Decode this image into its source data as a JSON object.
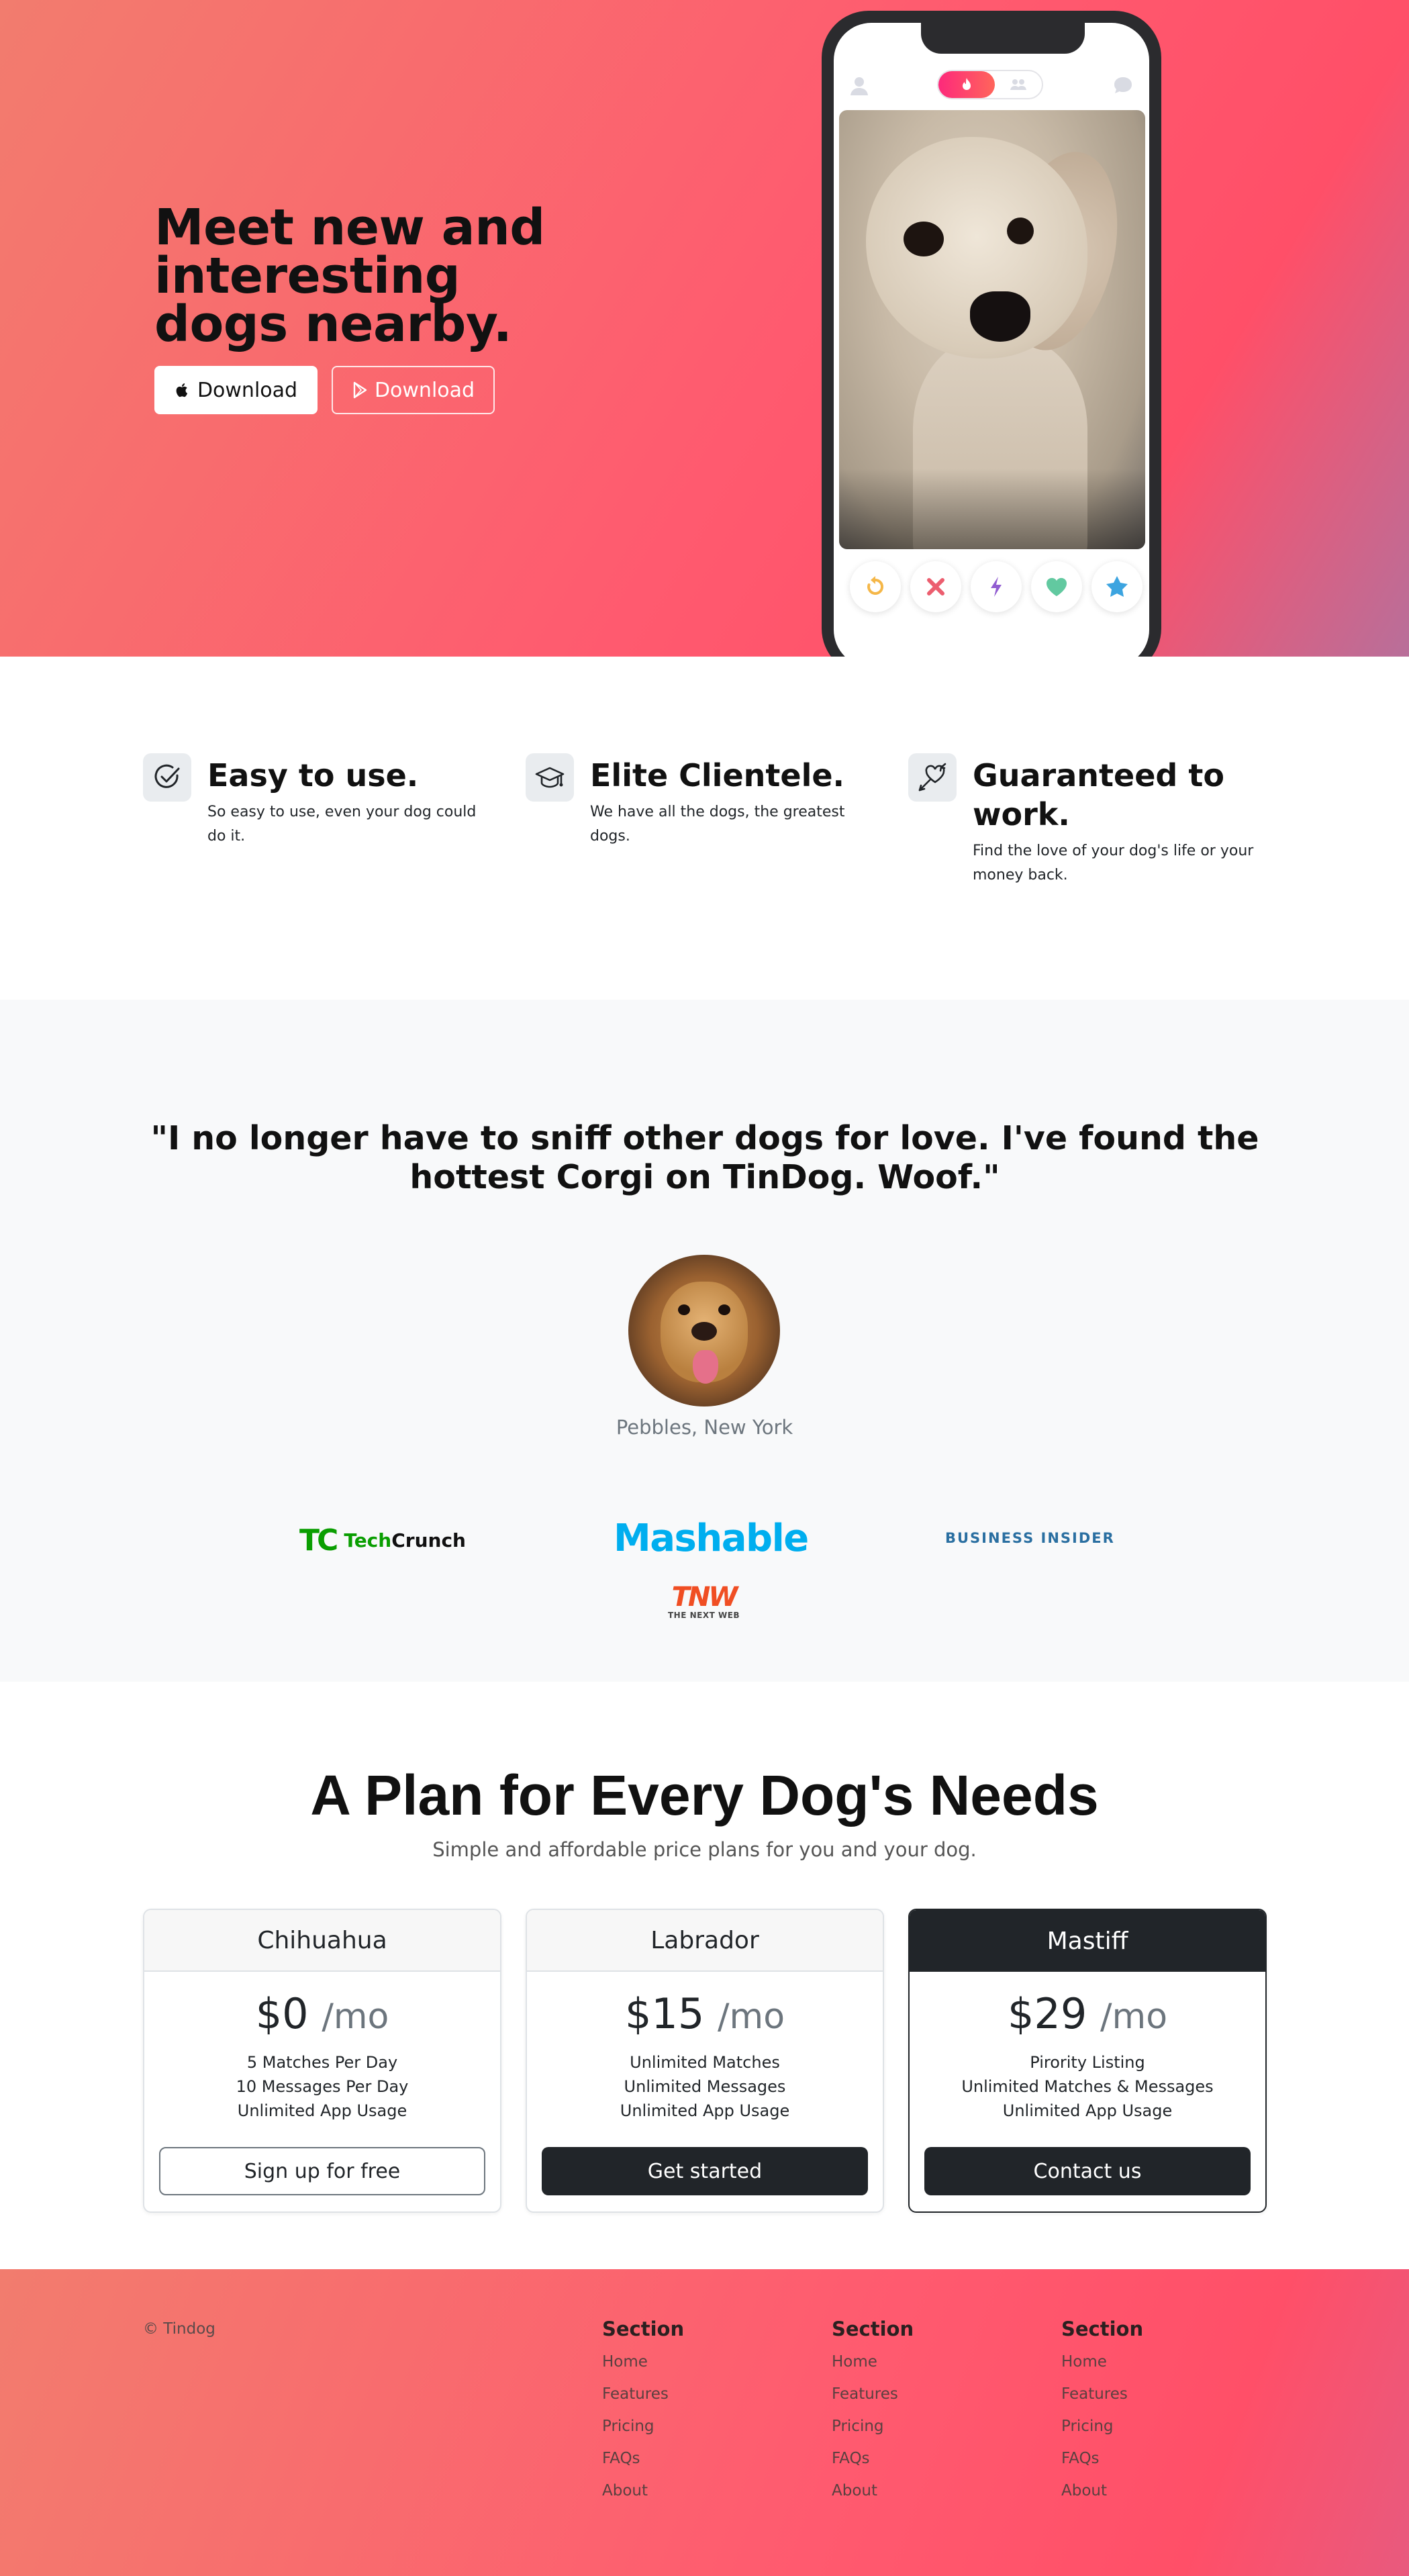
{
  "hero": {
    "title": "Meet new and interesting dogs nearby.",
    "buttons": [
      {
        "label": "Download",
        "icon": "apple-icon"
      },
      {
        "label": "Download",
        "icon": "google-play-icon"
      }
    ]
  },
  "phone": {
    "top_icons": [
      "profile-icon",
      "flame-icon",
      "community-icon",
      "chat-icon"
    ],
    "actions": [
      {
        "icon": "rewind-icon",
        "color": "#f5b748"
      },
      {
        "icon": "close-icon",
        "color": "#ec5e6f"
      },
      {
        "icon": "boost-icon",
        "color": "#915dd1"
      },
      {
        "icon": "heart-icon",
        "color": "#62c9a0"
      },
      {
        "icon": "star-icon",
        "color": "#3ca4e0"
      }
    ]
  },
  "features": [
    {
      "title": "Easy to use.",
      "text": "So easy to use, even your dog could do it.",
      "icon": "check-circle-icon"
    },
    {
      "title": "Elite Clientele.",
      "text": "We have all the dogs, the greatest dogs.",
      "icon": "graduation-cap-icon"
    },
    {
      "title": "Guaranteed to work.",
      "text": "Find the love of your dog's life or your money back.",
      "icon": "arrow-heart-icon"
    }
  ],
  "testimonial": {
    "quote": "\"I no longer have to sniff other dogs for love. I've found the hottest Corgi on TinDog. Woof.\"",
    "author": "Pebbles, New York"
  },
  "press_logos": {
    "techcrunch": {
      "mark": "TC",
      "word_a": "Tech",
      "word_b": "Crunch"
    },
    "mashable": "Mashable",
    "business_insider": "BUSINESS INSIDER",
    "tnw": {
      "main": "TNW",
      "sub": "THE NEXT WEB"
    }
  },
  "pricing": {
    "title": "A Plan for Every Dog's Needs",
    "subtitle": "Simple and affordable price plans for you and your dog.",
    "plans": [
      {
        "name": "Chihuahua",
        "price": "$0",
        "unit": "/mo",
        "features": [
          "5 Matches Per Day",
          "10 Messages Per Day",
          "Unlimited App Usage"
        ],
        "button": "Sign up for free"
      },
      {
        "name": "Labrador",
        "price": "$15",
        "unit": "/mo",
        "features": [
          "Unlimited Matches",
          "Unlimited Messages",
          "Unlimited App Usage"
        ],
        "button": "Get started"
      },
      {
        "name": "Mastiff",
        "price": "$29",
        "unit": "/mo",
        "features": [
          "Pirority Listing",
          "Unlimited Matches & Messages",
          "Unlimited App Usage"
        ],
        "button": "Contact us"
      }
    ]
  },
  "footer": {
    "copyright": "© Tindog",
    "columns": [
      {
        "title": "Section",
        "links": [
          "Home",
          "Features",
          "Pricing",
          "FAQs",
          "About"
        ]
      },
      {
        "title": "Section",
        "links": [
          "Home",
          "Features",
          "Pricing",
          "FAQs",
          "About"
        ]
      },
      {
        "title": "Section",
        "links": [
          "Home",
          "Features",
          "Pricing",
          "FAQs",
          "About"
        ]
      }
    ]
  },
  "colors": {
    "brand_gradient_start": "#f27c6e",
    "brand_gradient_mid": "#ff5a6f",
    "dark": "#212529"
  }
}
